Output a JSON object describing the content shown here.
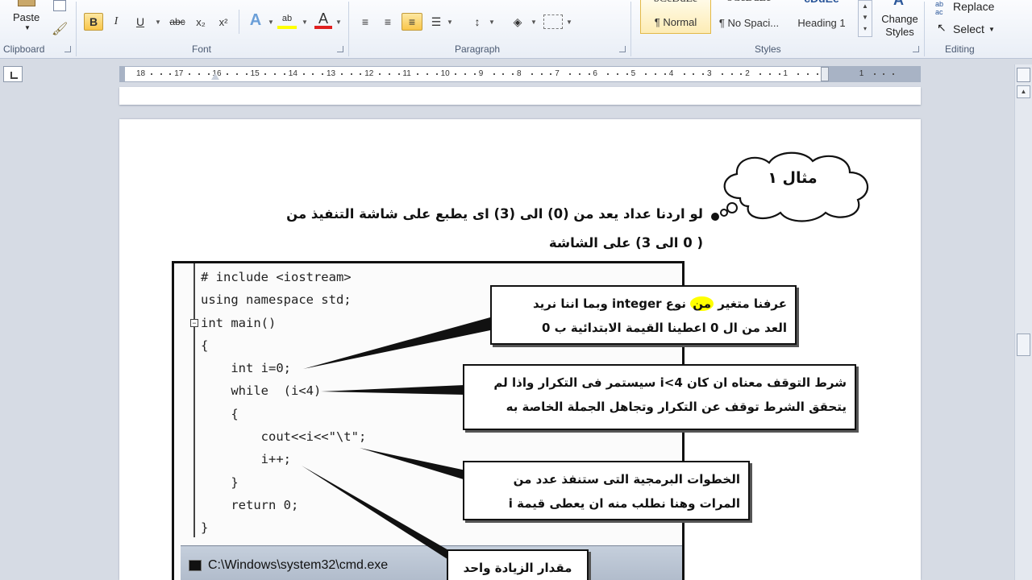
{
  "ribbon": {
    "clipboard": {
      "label": "Clipboard",
      "paste": "Paste"
    },
    "font": {
      "label": "Font",
      "bold": "B",
      "italic": "I",
      "underline": "U",
      "strike": "abc",
      "subscript": "x₂",
      "superscript": "x²",
      "font_color_letter": "A",
      "highlight_letters": "ab"
    },
    "paragraph": {
      "label": "Paragraph"
    },
    "styles": {
      "label": "Styles",
      "items": [
        {
          "sample": "bCcDdEe",
          "name": "¶ Normal"
        },
        {
          "sample": "bCcDdEe",
          "name": "¶ No Spaci..."
        },
        {
          "sample": "cDdEe",
          "name": "Heading 1"
        }
      ],
      "change_styles": "Change Styles"
    },
    "editing": {
      "label": "Editing",
      "replace": "Replace",
      "select": "Select"
    }
  },
  "ruler": {
    "numbers": [
      "18",
      "17",
      "16",
      "15",
      "14",
      "13",
      "12",
      "11",
      "10",
      "9",
      "8",
      "7",
      "6",
      "5",
      "4",
      "3",
      "2",
      "1",
      "1"
    ]
  },
  "document": {
    "cloud_label": "مثال ١",
    "intro_line1": "لو اردنا عداد يعد من (0) الى (3) اى يطبع على شاشة التنفيذ من",
    "intro_line2": "( 0 الى 3) على الشاشة",
    "code": [
      "# include <iostream>",
      "using namespace std;",
      "int main()",
      "{",
      "    int i=0;",
      "    while  (i<4)",
      "    {",
      "        cout<<i<<\"\\t\";",
      "        i++;",
      "    }",
      "    return 0;",
      "}"
    ],
    "cmd_title": "C:\\Windows\\system32\\cmd.exe",
    "callout1": {
      "pre": "عرفنا متغير ",
      "highlight": "من",
      "post": " نوع integer وبما اننا نريد",
      "line2": "العد من ال  0  اعطينا القيمة الابتدائية ب 0"
    },
    "callout2": {
      "line1": "شرط التوقف معناه ان كان i<4 سيستمر فى التكرار واذا لم",
      "line2": "يتحقق الشرط توقف عن التكرار وتجاهل الجملة الخاصة به"
    },
    "callout3": {
      "line1": "الخطوات البرمجية التى ستنفذ عدد من",
      "line2": "المرات وهنا نطلب منه ان يعطى قيمة  i"
    },
    "callout4": {
      "line1": "مقدار الزيادة واحد"
    }
  },
  "colors": {
    "highlight": "#ffff00",
    "pressed_button": "#f9c64a",
    "heading_style": "#2b579a"
  }
}
